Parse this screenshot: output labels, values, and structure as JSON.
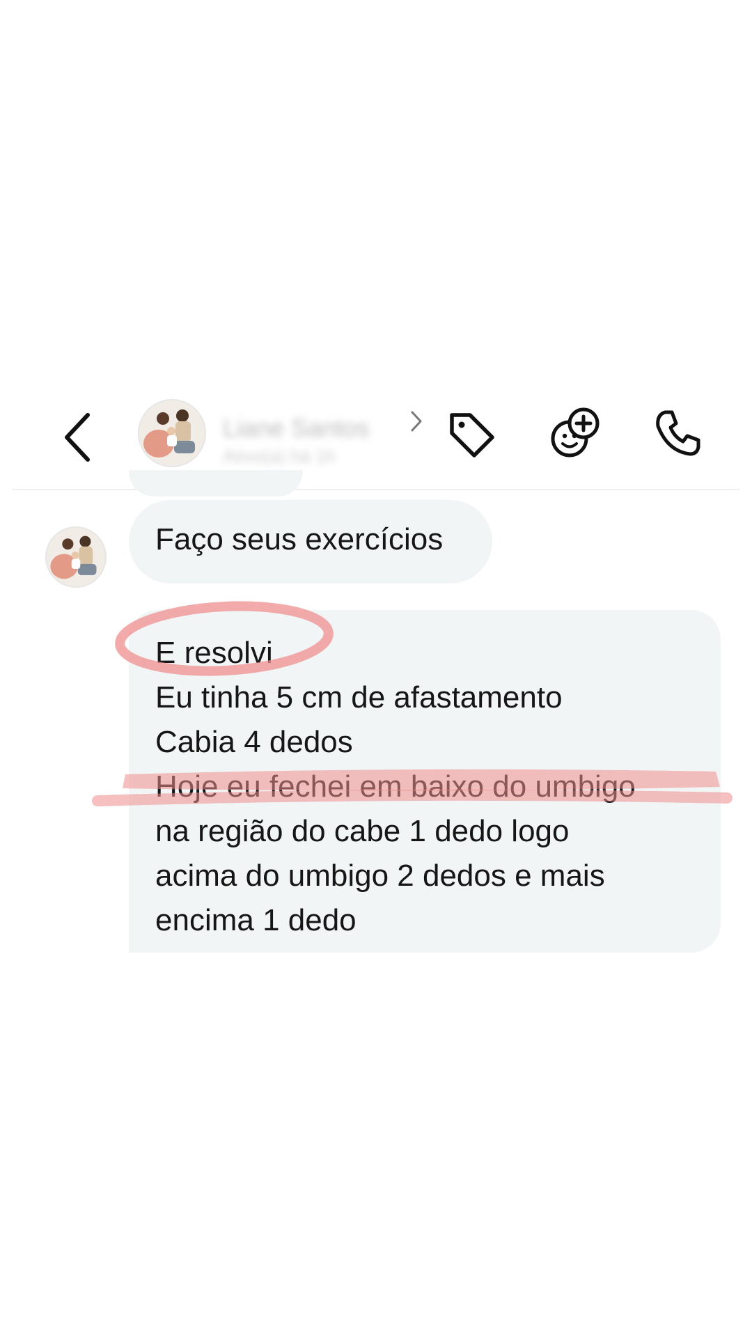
{
  "header": {
    "contact_name": "Liane Santos",
    "contact_status": "Ativo(a) há 1h",
    "icons": [
      "back-arrow-icon",
      "chevron-right-icon",
      "tag-icon",
      "add-sticker-icon",
      "phone-icon"
    ]
  },
  "messages": [
    {
      "id": "m1",
      "lines": [
        "Faço seus exercícios"
      ]
    },
    {
      "id": "m2",
      "lines": [
        "E resolvi",
        "Eu tinha 5 cm de afastamento",
        "Cabia 4 dedos",
        "Hoje eu fechei em baixo do umbigo",
        "na região do cabe 1 dedo logo",
        "acima do umbigo 2 dedos e mais",
        "encima 1 dedo"
      ]
    }
  ],
  "colors": {
    "bubble": "#f1f5f6",
    "highlight": "#ef8d8d",
    "icon": "#111111"
  }
}
